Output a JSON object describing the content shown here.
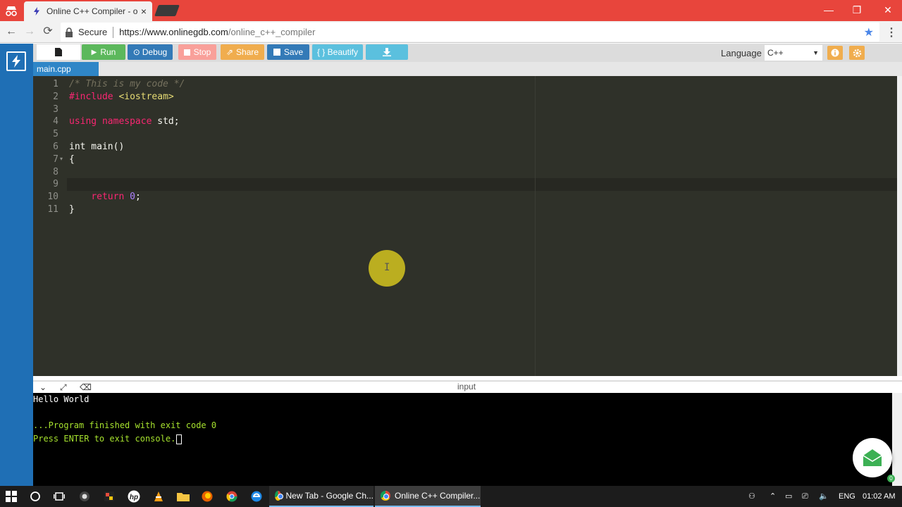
{
  "browser": {
    "tab_title": "Online C++ Compiler - o",
    "tab_close": "×",
    "secure_label": "Secure",
    "url_host": "https://www.onlinegdb.com",
    "url_path": "/online_c++_compiler",
    "window_controls": {
      "minimize": "—",
      "restore": "❐",
      "close": "✕"
    }
  },
  "toolbar": {
    "run_label": "Run",
    "debug_label": "Debug",
    "stop_label": "Stop",
    "share_label": "Share",
    "save_label": "Save",
    "beautify_label": "{ } Beautify",
    "language_label": "Language",
    "language_value": "C++",
    "colors": {
      "run": "#5cb85c",
      "debug": "#337ab7",
      "stop": "#f9a09a",
      "share": "#f0ad4e",
      "save": "#337ab7",
      "beautify": "#5bc0de",
      "download": "#5bc0de"
    }
  },
  "file_tab": "main.cpp",
  "editor": {
    "line_numbers": [
      "1",
      "2",
      "3",
      "4",
      "5",
      "6",
      "7",
      "8",
      "9",
      "10",
      "11"
    ],
    "lines": [
      {
        "n": 1,
        "segments": [
          {
            "cls": "cm",
            "text": "/* This is my code */"
          }
        ]
      },
      {
        "n": 2,
        "segments": [
          {
            "cls": "inc",
            "text": "#include "
          },
          {
            "cls": "str",
            "text": "<iostream>"
          }
        ]
      },
      {
        "n": 3,
        "segments": []
      },
      {
        "n": 4,
        "segments": [
          {
            "cls": "kw",
            "text": "using"
          },
          {
            "cls": "",
            "text": " "
          },
          {
            "cls": "kw",
            "text": "namespace"
          },
          {
            "cls": "",
            "text": " std;"
          }
        ]
      },
      {
        "n": 5,
        "segments": []
      },
      {
        "n": 6,
        "segments": [
          {
            "cls": "",
            "text": "int main()"
          }
        ]
      },
      {
        "n": 7,
        "segments": [
          {
            "cls": "",
            "text": "{"
          }
        ]
      },
      {
        "n": 8,
        "segments": []
      },
      {
        "n": 9,
        "segments": []
      },
      {
        "n": 10,
        "segments": [
          {
            "cls": "",
            "text": "    "
          },
          {
            "cls": "kw",
            "text": "return"
          },
          {
            "cls": "",
            "text": " "
          },
          {
            "cls": "num",
            "text": "0"
          },
          {
            "cls": "",
            "text": ";"
          }
        ]
      },
      {
        "n": 11,
        "segments": [
          {
            "cls": "",
            "text": "}"
          }
        ]
      }
    ],
    "fold_marker": "▾",
    "cursor_glyph": "I"
  },
  "console": {
    "title": "input",
    "lines": [
      {
        "text": "Hello World",
        "color": "#ffffff"
      },
      {
        "text": "",
        "color": "#ffffff"
      },
      {
        "text": "...Program finished with exit code 0",
        "color": "#a6e22e"
      },
      {
        "text": "Press ENTER to exit console.",
        "color": "#a6e22e"
      }
    ],
    "badge": "0"
  },
  "taskbar": {
    "app1_label": "New Tab - Google Ch...",
    "app2_label": "Online C++ Compiler...",
    "lang": "ENG",
    "time": "01:02 AM"
  }
}
